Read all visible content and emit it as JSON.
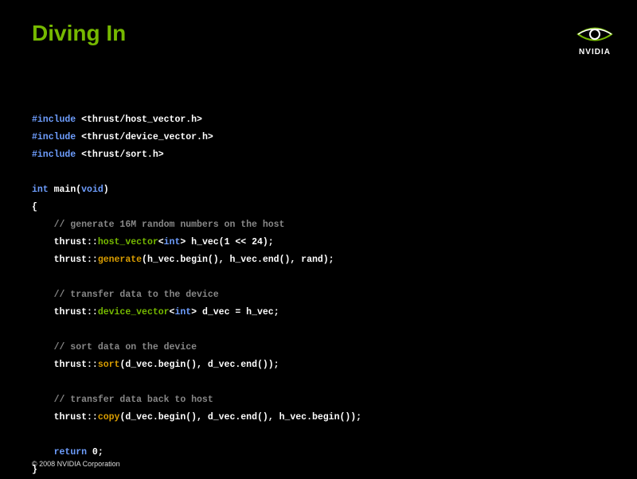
{
  "title": "Diving In",
  "brand": "NVIDIA",
  "footer": "© 2008 NVIDIA Corporation",
  "code": {
    "inc1a": "#include",
    "inc1b": " <thrust/host_vector.h>",
    "inc2a": "#include",
    "inc2b": " <thrust/device_vector.h>",
    "inc3a": "#include",
    "inc3b": " <thrust/sort.h>",
    "l1_int": "int",
    "l1_main": " main(",
    "l1_void": "void",
    "l1_close": ")",
    "l2": "{",
    "l3_cm": "    // generate 16M random numbers on the host",
    "l4a": "    thrust::",
    "l4b": "host_vector",
    "l4c": "<",
    "l4d": "int",
    "l4e": "> h_vec(1 << 24);",
    "l5a": "    thrust::",
    "l5b": "generate",
    "l5c": "(h_vec.begin(), h_vec.end(), rand);",
    "l6_cm": "    // transfer data to the device",
    "l7a": "    thrust::",
    "l7b": "device_vector",
    "l7c": "<",
    "l7d": "int",
    "l7e": "> d_vec = h_vec;",
    "l8_cm": "    // sort data on the device",
    "l9a": "    thrust::",
    "l9b": "sort",
    "l9c": "(d_vec.begin(), d_vec.end());",
    "l10_cm": "    // transfer data back to host",
    "l11a": "    thrust::",
    "l11b": "copy",
    "l11c": "(d_vec.begin(), d_vec.end(), h_vec.begin());",
    "l12a": "    ",
    "l12b": "return",
    "l12c": " 0;",
    "l13": "}"
  }
}
